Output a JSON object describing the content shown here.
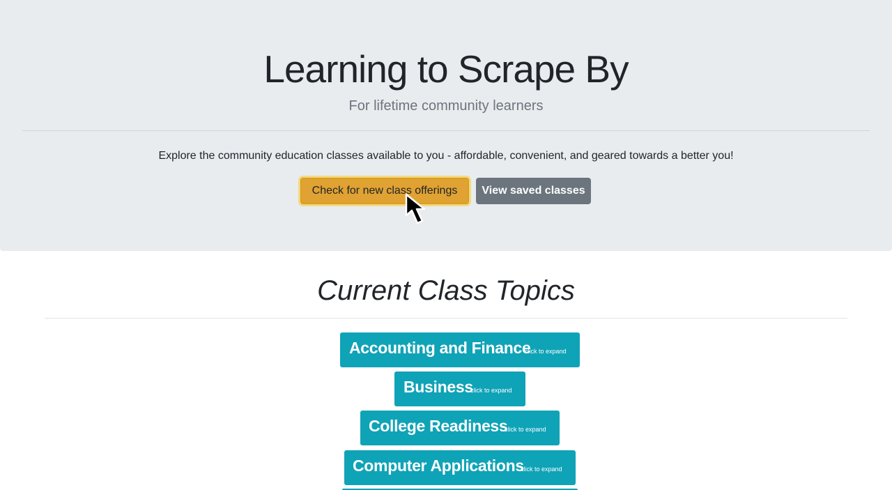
{
  "hero": {
    "title": "Learning to Scrape By",
    "subtitle": "For lifetime community learners",
    "lead": "Explore the community education classes available to you - affordable, convenient, and geared towards a better you!",
    "primary_button": "Check for new class offerings",
    "secondary_button": "View saved classes"
  },
  "topics_section": {
    "title": "Current Class Topics",
    "expand_hint": "click to expand",
    "items": [
      {
        "label": "Accounting and Finance"
      },
      {
        "label": "Business"
      },
      {
        "label": "College Readiness"
      },
      {
        "label": "Computer Applications"
      }
    ]
  },
  "colors": {
    "jumbotron_bg": "#e9ecef",
    "warning": "#e0a232",
    "secondary": "#6c757d",
    "info": "#0fa3b7"
  },
  "cursor": {
    "icon": "mouse-pointer-icon"
  }
}
